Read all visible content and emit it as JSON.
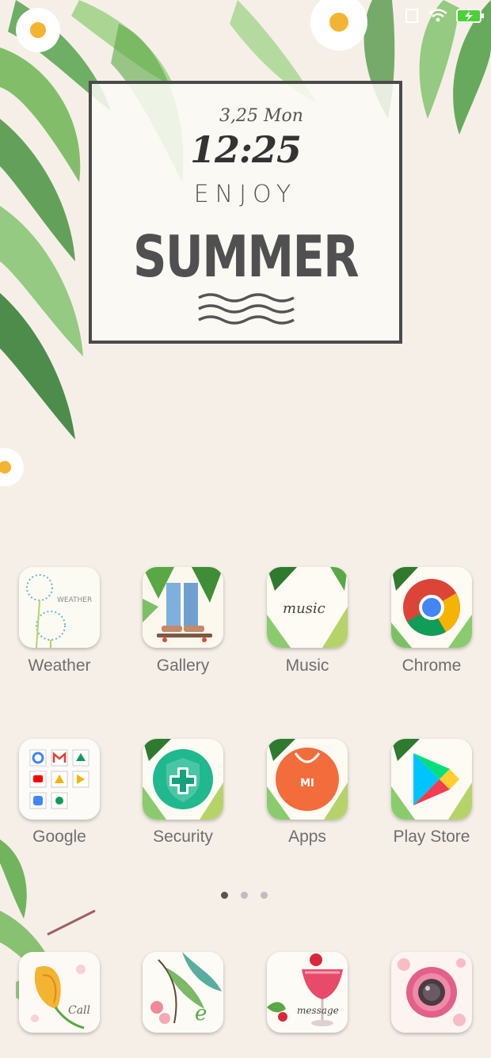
{
  "status_bar": {
    "icons": [
      "sim-icon",
      "wifi-icon",
      "battery-charging-icon"
    ],
    "battery_color": "#4cd137"
  },
  "clock_widget": {
    "date": "3,25  Mon",
    "time": "12:25",
    "line1": "ENJOY",
    "line2": "SUMMER"
  },
  "apps_row1": [
    {
      "label": "Weather",
      "icon": "weather-icon"
    },
    {
      "label": "Gallery",
      "icon": "gallery-icon"
    },
    {
      "label": "Music",
      "icon": "music-icon"
    },
    {
      "label": "Chrome",
      "icon": "chrome-icon"
    }
  ],
  "apps_row2": [
    {
      "label": "Google",
      "icon": "google-folder-icon"
    },
    {
      "label": "Security",
      "icon": "security-icon"
    },
    {
      "label": "Apps",
      "icon": "mi-apps-icon"
    },
    {
      "label": "Play Store",
      "icon": "play-store-icon"
    }
  ],
  "icon_texts": {
    "weather": "WEATHER",
    "music": "music",
    "mi": "MI",
    "call": "Call",
    "browser": "e",
    "message": "message"
  },
  "page_indicator": {
    "pages": 3,
    "current": 1
  },
  "dock": [
    {
      "name": "phone",
      "icon": "call-icon"
    },
    {
      "name": "browser",
      "icon": "browser-icon"
    },
    {
      "name": "messages",
      "icon": "message-icon"
    },
    {
      "name": "camera",
      "icon": "camera-icon"
    }
  ],
  "colors": {
    "background": "#f6efe8",
    "leaf": "#5aa845",
    "label": "#6e6e6e"
  }
}
